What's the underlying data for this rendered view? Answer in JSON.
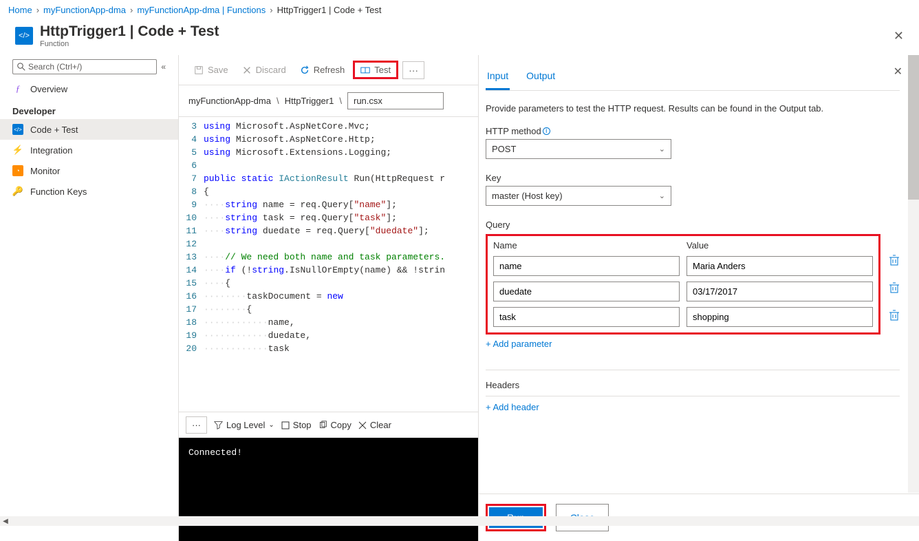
{
  "breadcrumbs": {
    "home": "Home",
    "app": "myFunctionApp-dma",
    "funcs": "myFunctionApp-dma | Functions",
    "current": "HttpTrigger1 | Code + Test"
  },
  "header": {
    "title": "HttpTrigger1 | Code + Test",
    "subtitle": "Function"
  },
  "search": {
    "placeholder": "Search (Ctrl+/)"
  },
  "nav": {
    "overview": "Overview",
    "developer_heading": "Developer",
    "code_test": "Code + Test",
    "integration": "Integration",
    "monitor": "Monitor",
    "function_keys": "Function Keys"
  },
  "toolbar": {
    "save": "Save",
    "discard": "Discard",
    "refresh": "Refresh",
    "test": "Test",
    "more": "···"
  },
  "path": {
    "seg1": "myFunctionApp-dma",
    "seg2": "HttpTrigger1",
    "file": "run.csx"
  },
  "code_lines": [
    "3",
    "4",
    "5",
    "6",
    "7",
    "8",
    "9",
    "10",
    "11",
    "12",
    "13",
    "14",
    "15",
    "16",
    "17",
    "18",
    "19",
    "20"
  ],
  "logbar": {
    "more": "···",
    "loglevel": "Log Level",
    "stop": "Stop",
    "copy": "Copy",
    "clear": "Clear"
  },
  "console": {
    "text": "Connected!"
  },
  "panel": {
    "tab_input": "Input",
    "tab_output": "Output",
    "desc": "Provide parameters to test the HTTP request. Results can be found in the Output tab.",
    "http_method_label": "HTTP method",
    "http_method_value": "POST",
    "key_label": "Key",
    "key_value": "master (Host key)",
    "query_label": "Query",
    "query_name_hdr": "Name",
    "query_value_hdr": "Value",
    "query_rows": [
      {
        "name": "name",
        "value": "Maria Anders"
      },
      {
        "name": "duedate",
        "value": "03/17/2017"
      },
      {
        "name": "task",
        "value": "shopping"
      }
    ],
    "add_parameter": "+ Add parameter",
    "headers_label": "Headers",
    "add_header": "+ Add header",
    "run": "Run",
    "close": "Close"
  }
}
